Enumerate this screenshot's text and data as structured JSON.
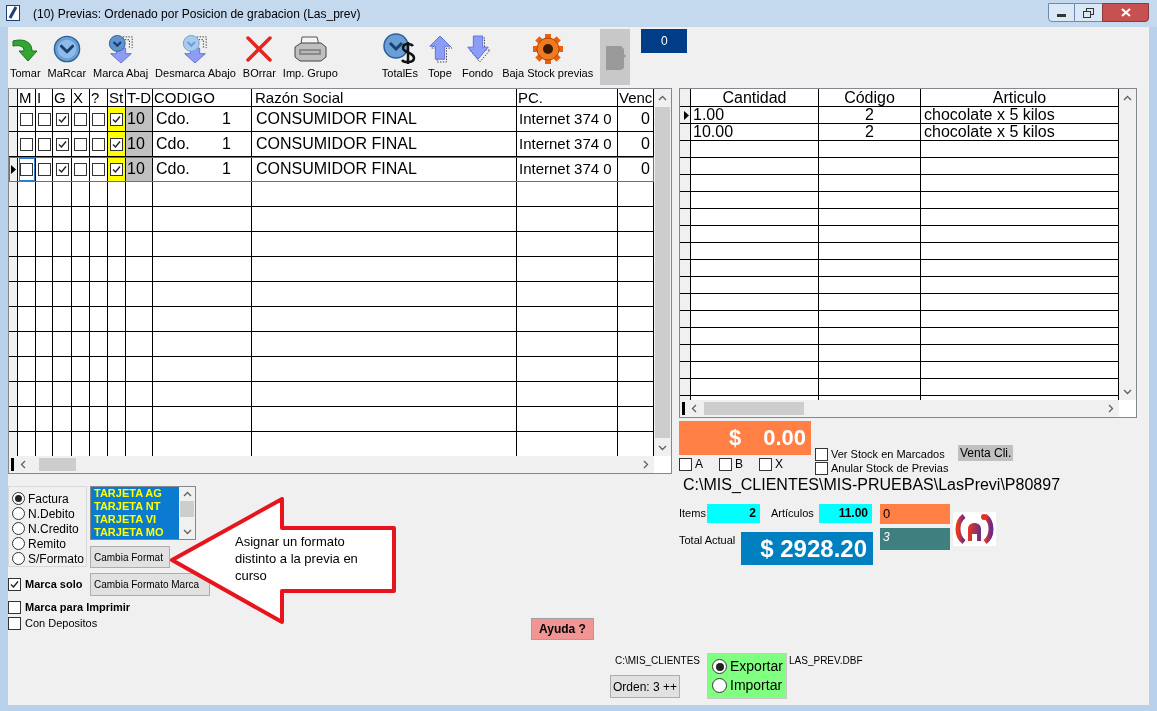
{
  "window": {
    "title": "(10) Previas: Ordenado por Posicion de grabacion (Las_prev)"
  },
  "toolbar": {
    "left": [
      {
        "kind": "take",
        "label": "Tomar",
        "disabled": false
      },
      {
        "kind": "mark",
        "label": "MaRcar",
        "disabled": false
      },
      {
        "kind": "markdown",
        "label": "Marca Abaj",
        "disabled": false
      },
      {
        "kind": "unmarkdown",
        "label": "Desmarca Abajo",
        "disabled": false
      },
      {
        "kind": "delete",
        "label": "BOrrar",
        "disabled": false
      },
      {
        "kind": "print",
        "label": "Imp. Grupo",
        "disabled": false
      }
    ],
    "right": [
      {
        "kind": "totals",
        "label": "TotalEs",
        "disabled": false
      },
      {
        "kind": "top",
        "label": "Tope",
        "disabled": false
      },
      {
        "kind": "bottom",
        "label": "Fondo",
        "disabled": false
      },
      {
        "kind": "stock",
        "label": "Baja Stock previas",
        "disabled": false
      },
      {
        "kind": "blank",
        "disabled": true
      }
    ],
    "counter": "0"
  },
  "previas": {
    "columns": [
      "M",
      "I",
      "G",
      "X",
      "?",
      "St",
      "T-D",
      "CODIGO",
      "Razón Social",
      "PC.",
      "Venc"
    ],
    "rows": [
      {
        "selected": false,
        "marks": [
          {
            "checked": false
          },
          {
            "checked": false
          },
          {
            "checked": true
          },
          {
            "checked": false
          },
          {
            "checked": false
          },
          {
            "checked": true
          }
        ],
        "td": "10",
        "tipo": "Cdo.",
        "codigo": "1",
        "razon_social": "CONSUMIDOR FINAL",
        "pc": "Internet 374 0",
        "venc": "0"
      },
      {
        "selected": false,
        "marks": [
          {
            "checked": false
          },
          {
            "checked": false
          },
          {
            "checked": true
          },
          {
            "checked": false
          },
          {
            "checked": false
          },
          {
            "checked": true
          }
        ],
        "td": "10",
        "tipo": "Cdo.",
        "codigo": "1",
        "razon_social": "CONSUMIDOR FINAL",
        "pc": "Internet 374 0",
        "venc": "0"
      },
      {
        "selected": true,
        "marks": [
          {
            "checked": false
          },
          {
            "checked": false
          },
          {
            "checked": true
          },
          {
            "checked": false
          },
          {
            "checked": false
          },
          {
            "checked": true
          }
        ],
        "td": "10",
        "tipo": "Cdo.",
        "codigo": "1",
        "razon_social": "CONSUMIDOR FINAL",
        "pc": "Internet 374 0",
        "venc": "0"
      }
    ]
  },
  "articulos": {
    "columns": [
      "Cantidad",
      "Código",
      "Articulo"
    ],
    "rows": [
      {
        "selected": true,
        "cantidad": "1.00",
        "codigo": "2",
        "articulo": "chocolate x 5 kilos"
      },
      {
        "selected": false,
        "cantidad": "10.00",
        "codigo": "2",
        "articulo": "chocolate x 5 kilos"
      }
    ]
  },
  "marcados": {
    "currency": "$",
    "amount": "0.00",
    "filters": [
      {
        "label": "A",
        "checked": false
      },
      {
        "label": "B",
        "checked": false
      },
      {
        "label": "X",
        "checked": false
      }
    ]
  },
  "stock_options": [
    {
      "label": "Ver Stock en Marcados",
      "checked": false
    },
    {
      "label": "Anular Stock de Previas",
      "checked": false
    }
  ],
  "venta_cli": "Venta Cli.",
  "path": "C:\\MIS_CLIENTES\\MIS-PRUEBAS\\LasPrevi\\P80897",
  "totals": {
    "items_label": "Items",
    "items": "2",
    "articulos_label": "Artículos",
    "articulos": "11.00",
    "total_label": "Total Actual",
    "total": "$ 2928.20",
    "box_1": "0",
    "box_2": "3"
  },
  "doc_types": [
    {
      "label": "Factura",
      "selected": true
    },
    {
      "label": "N.Debito",
      "selected": false
    },
    {
      "label": "N.Credito",
      "selected": false
    },
    {
      "label": "Remito",
      "selected": false
    },
    {
      "label": "S/Formato",
      "selected": false
    }
  ],
  "formats": [
    "TARJETA AG",
    "TARJETA NT",
    "TARJETA VI",
    "TARJETA MO"
  ],
  "format_buttons": [
    "Cambia Format",
    "Cambia Formato Marca"
  ],
  "options": [
    {
      "kind": "strong",
      "label": "Marca solo",
      "checked": true
    },
    {
      "kind": "strong",
      "label": "Marca para Imprimir",
      "checked": false
    },
    {
      "kind": "plain",
      "label": "Con Depositos",
      "checked": false
    }
  ],
  "callout": "Asignar un formato distinto a la previa en curso",
  "help_button": "Ayuda ?",
  "dbf_path": [
    "C:\\MIS_CLIENTES",
    "LAS_PREV.DBF"
  ],
  "order_button": "Orden: 3 ++",
  "transfer": [
    {
      "label": "Exportar",
      "selected": true
    },
    {
      "label": "Importar",
      "selected": false
    }
  ]
}
